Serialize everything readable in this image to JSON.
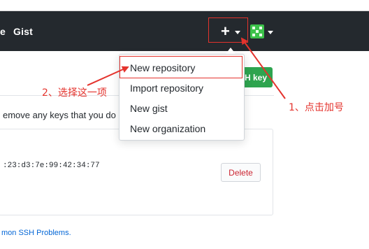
{
  "navbar": {
    "partial_link": "e",
    "gist_label": "Gist",
    "plus_symbol": "+"
  },
  "create_menu": {
    "items": [
      {
        "label": "New repository"
      },
      {
        "label": "Import repository"
      },
      {
        "label": "New gist"
      },
      {
        "label": "New organization"
      }
    ]
  },
  "ssh": {
    "new_key_button_partial": "H key",
    "remove_text_partial": "emove any keys that you do",
    "key_fingerprint_partial": ":23:d3:7e:99:42:34:77",
    "delete_label": "Delete",
    "help_link_partial": "mon SSH Problems."
  },
  "annotations": {
    "step1": "1、点击加号",
    "step2": "2、选择这一项"
  },
  "colors": {
    "navbar_bg": "#24292e",
    "annotation_red": "#e4332d",
    "primary_green": "#2ea44f",
    "danger_red": "#cb2431",
    "link_blue": "#0366d6"
  },
  "icons": {
    "plus": "plus-icon",
    "caret": "caret-down-icon",
    "avatar": "identicon-avatar"
  }
}
